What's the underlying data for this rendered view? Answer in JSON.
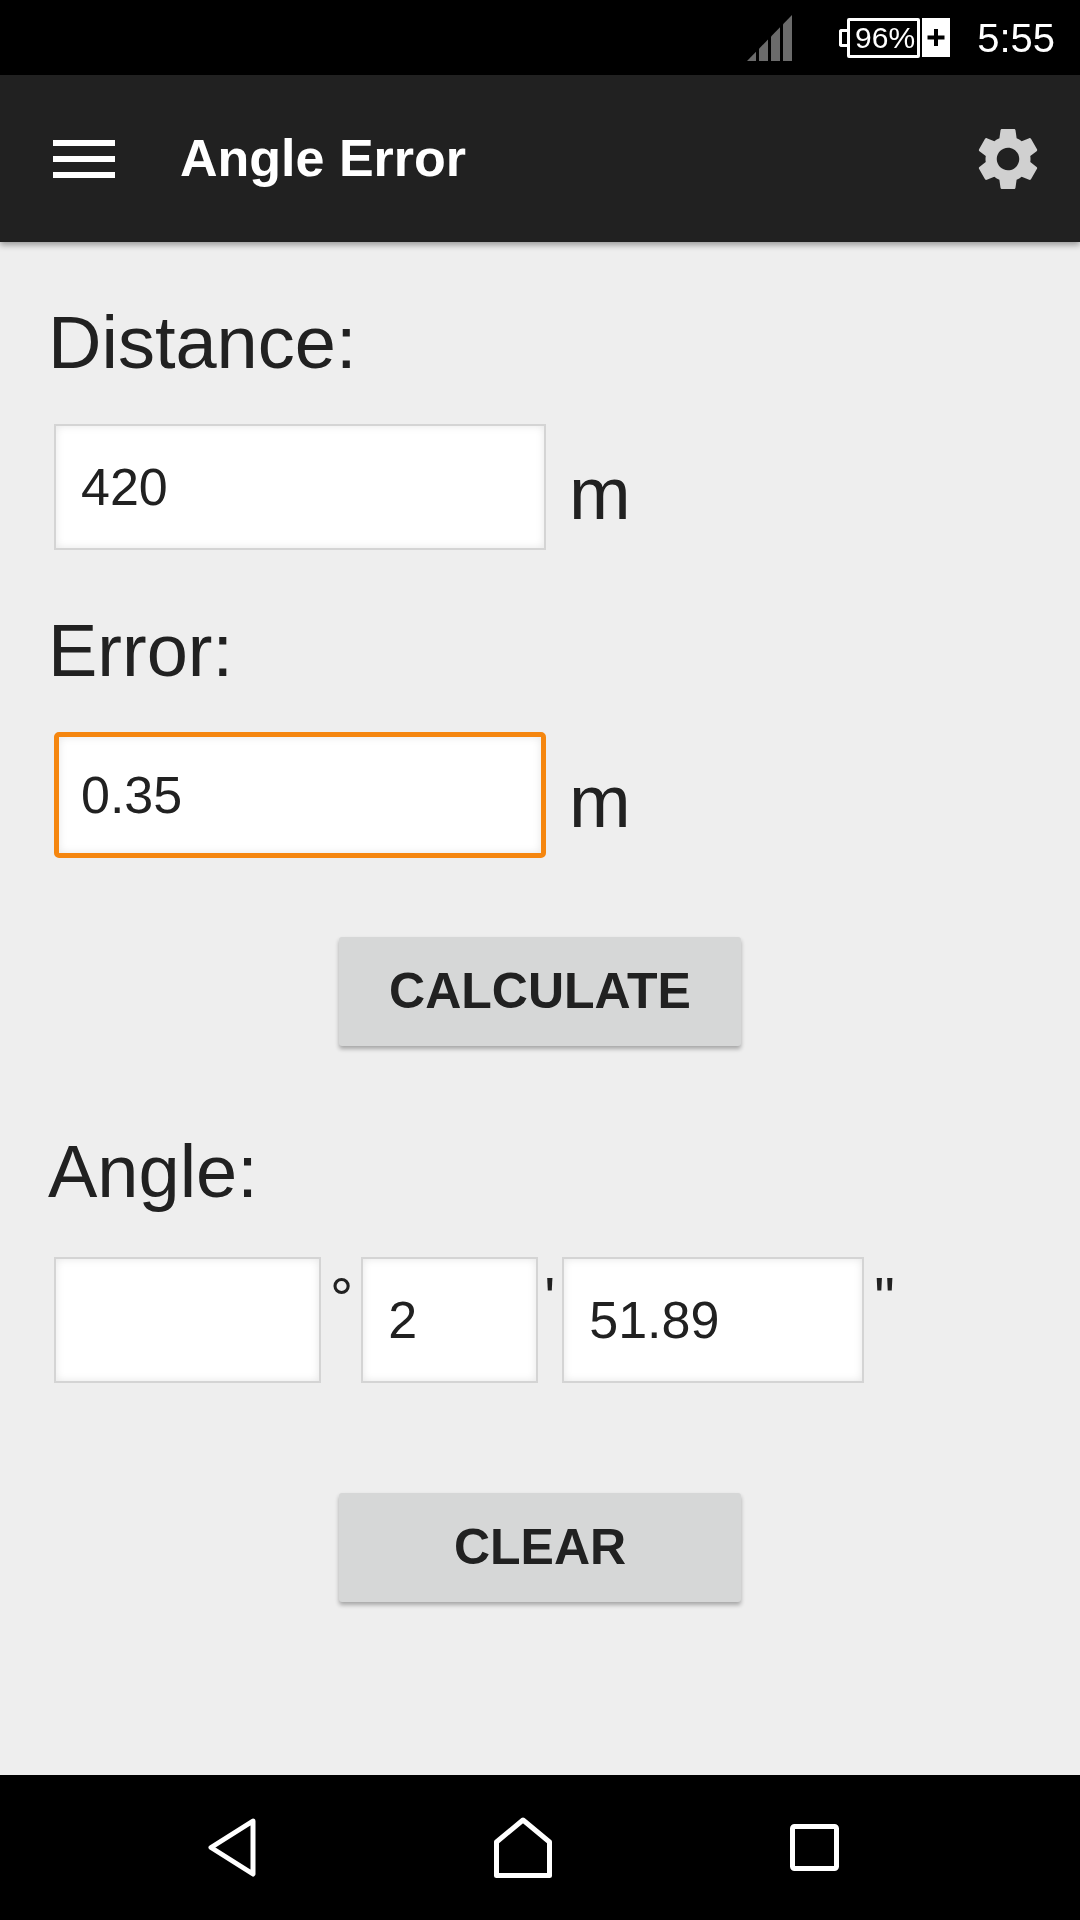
{
  "status_bar": {
    "battery": "96%",
    "charging": true,
    "time": "5:55"
  },
  "app_bar": {
    "title": "Angle Error"
  },
  "inputs": [
    {
      "label": "Distance:",
      "value": "420",
      "unit": "m",
      "focused": false
    },
    {
      "label": "Error:",
      "value": "0.35",
      "unit": "m",
      "focused": true
    }
  ],
  "calculate_button": {
    "label": "CALCULATE"
  },
  "angle": {
    "label": "Angle:",
    "fields": [
      {
        "unit": "°",
        "focused": false
      },
      {
        "value": "2",
        "unit": "'",
        "focused": false
      },
      {
        "value": "51.89",
        "unit": "\"",
        "focused": false
      }
    ]
  },
  "clear_button": {
    "label": "CLEAR"
  }
}
